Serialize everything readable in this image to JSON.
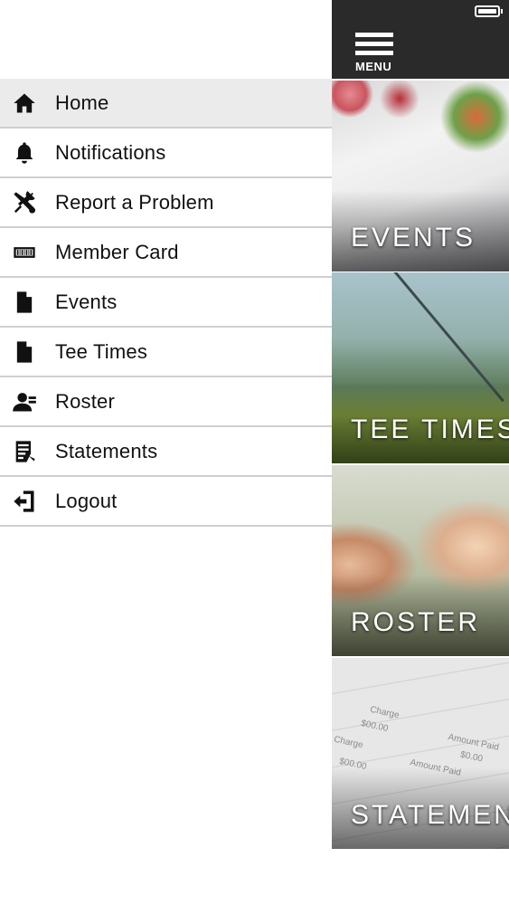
{
  "menu": {
    "items": [
      {
        "label": "Home",
        "icon": "home-icon",
        "active": true
      },
      {
        "label": "Notifications",
        "icon": "bell-icon",
        "active": false
      },
      {
        "label": "Report a Problem",
        "icon": "tools-icon",
        "active": false
      },
      {
        "label": "Member Card",
        "icon": "barcode-card-icon",
        "active": false
      },
      {
        "label": "Events",
        "icon": "document-icon",
        "active": false
      },
      {
        "label": "Tee Times",
        "icon": "document-icon",
        "active": false
      },
      {
        "label": "Roster",
        "icon": "user-icon",
        "active": false
      },
      {
        "label": "Statements",
        "icon": "statement-icon",
        "active": false
      },
      {
        "label": "Logout",
        "icon": "logout-icon",
        "active": false
      }
    ]
  },
  "topbar": {
    "menu_button_label": "MENU"
  },
  "tiles": [
    {
      "title": "EVENTS"
    },
    {
      "title": "TEE TIMES"
    },
    {
      "title": "ROSTER"
    },
    {
      "title": "STATEMENTS"
    }
  ],
  "statement_image_text": {
    "charge1": "Charge",
    "amount1": "$00.00",
    "charge2": "Charge",
    "amount_paid1": "Amount Paid",
    "amount2": "$0.00",
    "amount_paid2": "Amount Paid",
    "amount3": "$00.00"
  },
  "colors": {
    "topbar": "#2a2a2a",
    "active_item": "#ebebeb",
    "divider": "#cfcfcf"
  }
}
